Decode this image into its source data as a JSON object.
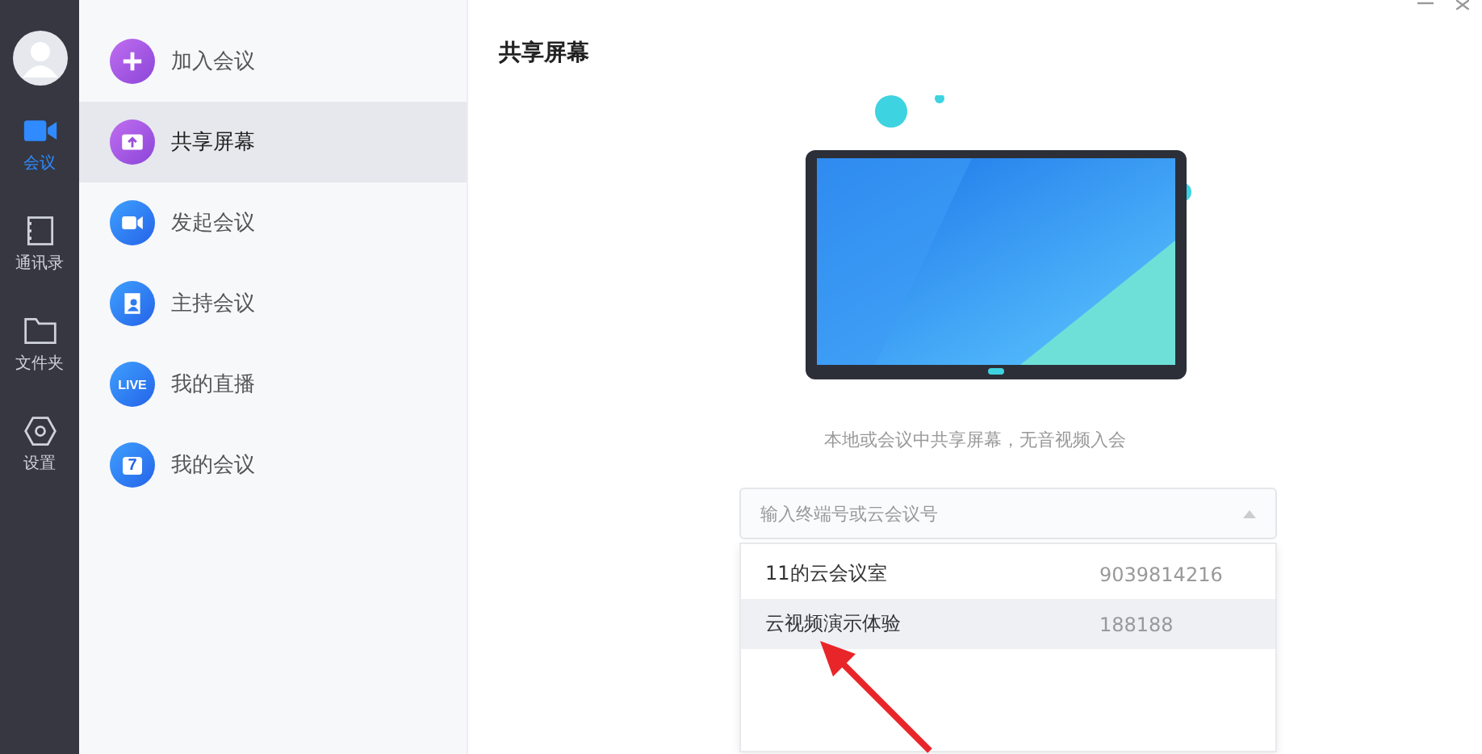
{
  "rail": {
    "items": [
      {
        "label": "会议",
        "selected": true
      },
      {
        "label": "通讯录",
        "selected": false
      },
      {
        "label": "文件夹",
        "selected": false
      },
      {
        "label": "设置",
        "selected": false
      }
    ]
  },
  "menu": {
    "items": [
      {
        "label": "加入会议",
        "selected": false
      },
      {
        "label": "共享屏幕",
        "selected": true
      },
      {
        "label": "发起会议",
        "selected": false
      },
      {
        "label": "主持会议",
        "selected": false
      },
      {
        "label": "我的直播",
        "selected": false,
        "icon_text": "LIVE"
      },
      {
        "label": "我的会议",
        "selected": false,
        "icon_text": "7"
      }
    ]
  },
  "panel": {
    "title": "共享屏幕",
    "caption": "本地或会议中共享屏幕，无音视频入会",
    "select": {
      "placeholder": "输入终端号或云会议号",
      "expanded": true
    },
    "options": [
      {
        "name": "11的云会议室",
        "number": "9039814216",
        "selected": false
      },
      {
        "name": "云视频演示体验",
        "number": "188188",
        "selected": true
      }
    ]
  }
}
